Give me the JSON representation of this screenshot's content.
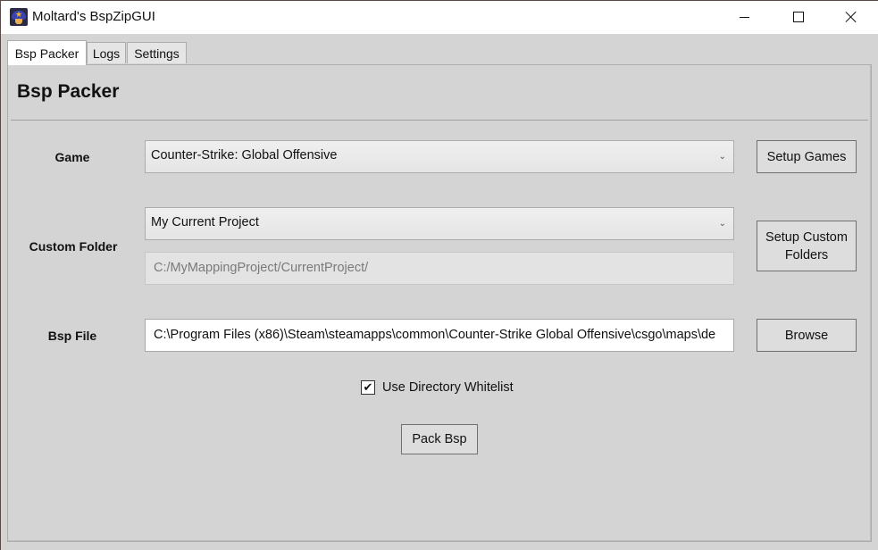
{
  "window": {
    "title": "Moltard's BspZipGUI",
    "icon": "mushroom-app-icon",
    "controls": {
      "minimize": "minimize-icon",
      "maximize": "maximize-icon",
      "close": "close-icon"
    }
  },
  "tabs": [
    {
      "label": "Bsp Packer",
      "active": true
    },
    {
      "label": "Logs",
      "active": false
    },
    {
      "label": "Settings",
      "active": false
    }
  ],
  "panel": {
    "title": "Bsp Packer",
    "game": {
      "label": "Game",
      "selected": "Counter-Strike: Global Offensive",
      "setup_button": "Setup Games"
    },
    "custom_folder": {
      "label": "Custom Folder",
      "selected": "My Current Project",
      "path": "C:/MyMappingProject/CurrentProject/",
      "setup_button": "Setup Custom Folders"
    },
    "bsp_file": {
      "label": "Bsp File",
      "value": "C:\\Program Files (x86)\\Steam\\steamapps\\common\\Counter-Strike Global Offensive\\csgo\\maps\\de",
      "browse_button": "Browse"
    },
    "whitelist": {
      "label": "Use Directory Whitelist",
      "checked": true,
      "check_glyph": "✔"
    },
    "pack_button": "Pack Bsp"
  }
}
